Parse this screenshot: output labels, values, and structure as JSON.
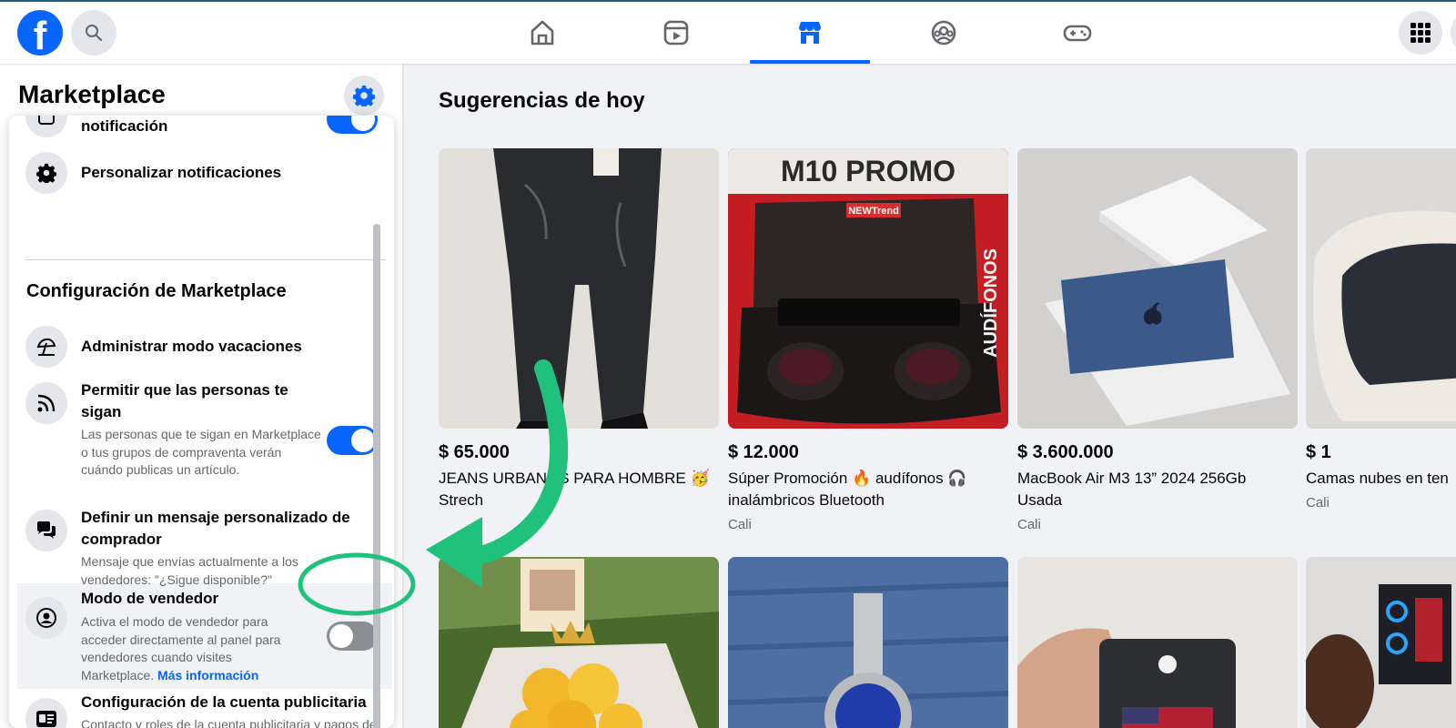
{
  "topbar": {
    "logo": "f",
    "nav_tabs": [
      "home",
      "video",
      "marketplace",
      "groups",
      "gaming"
    ],
    "active_tab": "marketplace"
  },
  "sidebar": {
    "title": "Marketplace",
    "items": [
      {
        "title": "notificación"
      },
      {
        "title": "Personalizar notificaciones"
      },
      {
        "title": "Administrar modo vacaciones"
      },
      {
        "title": "Permitir que las personas te sigan",
        "sub": "Las personas que te sigan en Marketplace o tus grupos de compraventa verán cuándo publicas un artículo.",
        "toggle": "on"
      },
      {
        "title": "Definir un mensaje personalizado de comprador",
        "sub": "Mensaje que envías actualmente a los vendedores: \"¿Sigue disponible?\""
      },
      {
        "title": "Modo de vendedor",
        "sub": "Activa el modo de vendedor para acceder directamente al panel para vendedores cuando visites Marketplace.",
        "link": "Más información",
        "toggle": "off"
      },
      {
        "title": "Configuración de la cuenta publicitaria",
        "sub": "Contacto y roles de la cuenta publicitaria y pagos del negocio."
      }
    ],
    "section_header": "Configuración de Marketplace"
  },
  "main": {
    "title": "Sugerencias de hoy",
    "listings": [
      {
        "price": "$ 65.000",
        "title": "JEANS URBANOS PARA HOMBRE 🥳 Strech",
        "location": ""
      },
      {
        "price": "$ 12.000",
        "title": "Súper Promoción 🔥 audífonos 🎧 inalámbricos Bluetooth",
        "location": "Cali",
        "image_text": "M10 PROMO",
        "brand": "NEWTrend",
        "side_text": "AUDÍFONOS"
      },
      {
        "price": "$ 3.600.000",
        "title": "MacBook Air M3 13” 2024 256Gb Usada",
        "location": "Cali"
      },
      {
        "price": "$ 1",
        "title": "Camas nubes en ten",
        "location": "Cali"
      }
    ]
  },
  "colors": {
    "accent": "#0866ff",
    "annotation": "#1fc17b"
  }
}
